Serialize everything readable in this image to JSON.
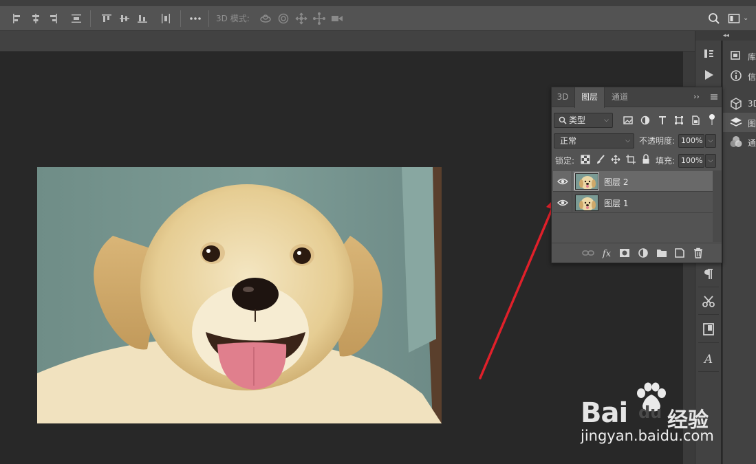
{
  "options_bar": {
    "mode_label": "3D 模式:"
  },
  "layers_panel": {
    "tabs": [
      {
        "label": "3D"
      },
      {
        "label": "图层"
      },
      {
        "label": "通道"
      }
    ],
    "filter_kind": "类型",
    "blend_mode": "正常",
    "opacity_label": "不透明度:",
    "opacity_value": "100%",
    "lock_label": "锁定:",
    "fill_label": "填充:",
    "fill_value": "100%",
    "layers": [
      {
        "name": "图层 2",
        "selected": true
      },
      {
        "name": "图层 1",
        "selected": false
      }
    ]
  },
  "right_dock": {
    "items": [
      {
        "label": "库",
        "icon": "library-icon"
      },
      {
        "label": "信",
        "icon": "info-icon"
      },
      {
        "label": "3D",
        "icon": "cube-icon"
      },
      {
        "label": "图",
        "icon": "layers-icon"
      },
      {
        "label": "通",
        "icon": "channels-icon"
      }
    ]
  },
  "watermark": {
    "brand": "Bai",
    "brand_tail": "du",
    "brand_cn": "经验",
    "url": "jingyan.baidu.com"
  },
  "colors": {
    "annotation_arrow": "#e0202a",
    "ui_dark": "#282828",
    "panel": "#535353"
  }
}
